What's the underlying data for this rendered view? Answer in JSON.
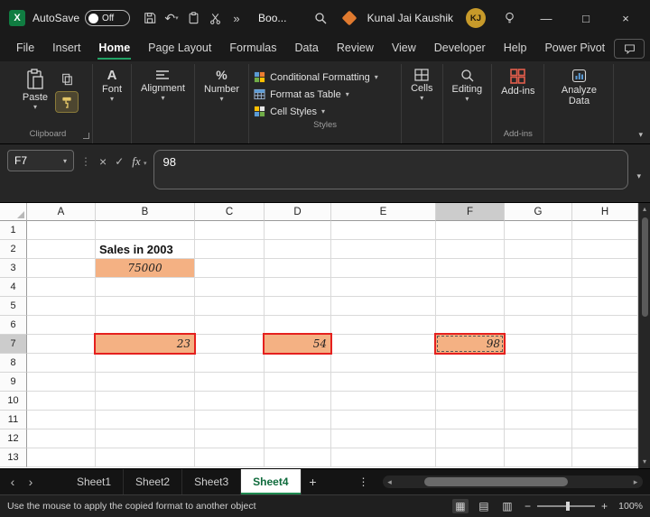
{
  "titlebar": {
    "autosave_label": "AutoSave",
    "autosave_state": "Off",
    "workbook_name": "Boo...",
    "user_name": "Kunal Jai Kaushik",
    "user_initials": "KJ"
  },
  "menubar": {
    "tabs": [
      "File",
      "Insert",
      "Home",
      "Page Layout",
      "Formulas",
      "Data",
      "Review",
      "View",
      "Developer",
      "Help",
      "Power Pivot"
    ],
    "active_tab": "Home"
  },
  "ribbon": {
    "paste": "Paste",
    "groups": {
      "clipboard": "Clipboard",
      "styles": "Styles",
      "addins": "Add-ins"
    },
    "buttons": {
      "font": "Font",
      "alignment": "Alignment",
      "number": "Number",
      "cells": "Cells",
      "editing": "Editing",
      "addins": "Add-ins",
      "analyze": "Analyze Data"
    },
    "styles_items": [
      "Conditional Formatting",
      "Format as Table",
      "Cell Styles"
    ]
  },
  "formula_bar": {
    "name_box": "F7",
    "fx": "fx",
    "value": "98"
  },
  "grid": {
    "columns": [
      "A",
      "B",
      "C",
      "D",
      "E",
      "F",
      "G",
      "H"
    ],
    "row_count": 13,
    "selected_column": "F",
    "selected_row": 7,
    "cells": [
      {
        "ref": "B2",
        "col": "B",
        "row": 2,
        "text": "Sales in 2003",
        "style": "label-bold"
      },
      {
        "ref": "B3",
        "col": "B",
        "row": 3,
        "text": "75000",
        "style": "fill-center"
      },
      {
        "ref": "B7",
        "col": "B",
        "row": 7,
        "text": "23",
        "style": "fill-red"
      },
      {
        "ref": "D7",
        "col": "D",
        "row": 7,
        "text": "54",
        "style": "fill-red"
      },
      {
        "ref": "F7",
        "col": "F",
        "row": 7,
        "text": "98",
        "style": "fill-red marquee"
      }
    ],
    "colors": {
      "cell_fill": "#F4B183",
      "highlight_border": "#E5201E"
    }
  },
  "sheet_bar": {
    "tabs": [
      "Sheet1",
      "Sheet2",
      "Sheet3",
      "Sheet4"
    ],
    "active_tab": "Sheet4"
  },
  "status_bar": {
    "message": "Use the mouse to apply the copied format to another object",
    "zoom_level": "100%"
  }
}
